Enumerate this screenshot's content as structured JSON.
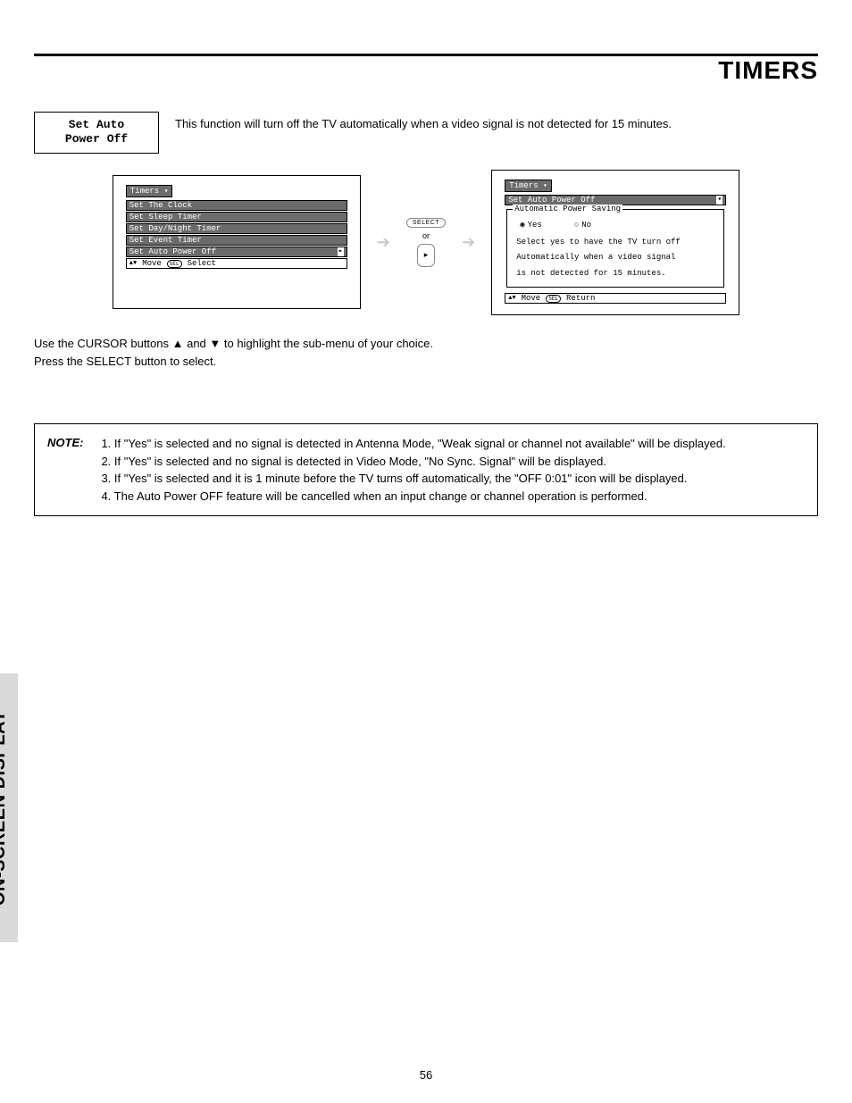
{
  "header": {
    "title": "TIMERS"
  },
  "feature": {
    "line1": "Set Auto",
    "line2": "Power Off",
    "description": "This function will turn off the TV automatically when a video signal is not detected for 15 minutes."
  },
  "osd_left": {
    "tab": "Timers",
    "items": [
      "Set The Clock",
      "Set Sleep Timer",
      "Set Day/Night Timer",
      "Set Event Timer",
      "Set Auto Power Off"
    ],
    "footer_move": "Move",
    "footer_sel_icon": "SEL",
    "footer_select": "Select"
  },
  "middle": {
    "select_label": "SELECT",
    "or": "or"
  },
  "osd_right": {
    "tab": "Timers",
    "active_item": "Set Auto Power Off",
    "group_label": "Automatic Power Saving",
    "opt_yes": "Yes",
    "opt_no": "No",
    "help1": "Select yes to have the TV turn off",
    "help2": "Automatically when a video signal",
    "help3": "is not detected for 15 minutes.",
    "footer_move": "Move",
    "footer_sel_icon": "SEL",
    "footer_return": "Return"
  },
  "instructions": {
    "line1": "Use the CURSOR buttons ▲ and ▼ to highlight the sub-menu of your choice.",
    "line2": "Press the SELECT button to select."
  },
  "note": {
    "label": "NOTE:",
    "items": [
      "1. If \"Yes\" is selected and no signal is detected in Antenna Mode, \"Weak signal or channel not available\" will be displayed.",
      "2. If \"Yes\" is selected and no signal is detected in Video Mode, \"No Sync. Signal\" will be displayed.",
      "3. If \"Yes\" is selected and it is 1 minute before the TV turns off automatically, the \"OFF 0:01\" icon will be displayed.",
      "4. The Auto Power OFF feature will be cancelled when an input change or channel operation is performed."
    ]
  },
  "side_tab": "ON-SCREEN DISPLAY",
  "page_number": "56"
}
